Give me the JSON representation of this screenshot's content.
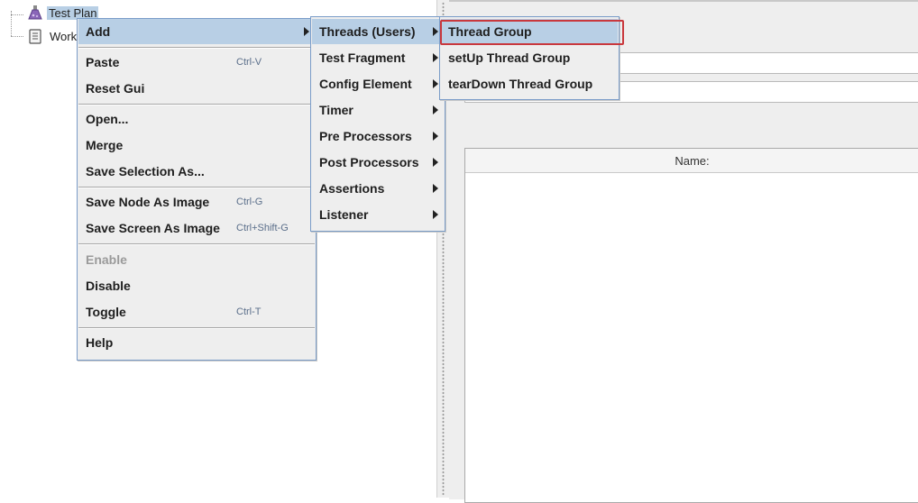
{
  "tree": {
    "root_label": "Test Plan",
    "child_label": "Work"
  },
  "right_panel": {
    "table_header": "Name:"
  },
  "context_menu": {
    "items": [
      {
        "label": "Add",
        "has_submenu": true
      },
      {
        "label": "Paste",
        "shortcut": "Ctrl-V"
      },
      {
        "label": "Reset Gui"
      },
      {
        "label": "Open..."
      },
      {
        "label": "Merge"
      },
      {
        "label": "Save Selection As..."
      },
      {
        "label": "Save Node As Image",
        "shortcut": "Ctrl-G"
      },
      {
        "label": "Save Screen As Image",
        "shortcut": "Ctrl+Shift-G"
      },
      {
        "label": "Enable",
        "disabled": true
      },
      {
        "label": "Disable"
      },
      {
        "label": "Toggle",
        "shortcut": "Ctrl-T"
      },
      {
        "label": "Help"
      }
    ]
  },
  "add_submenu": {
    "items": [
      {
        "label": "Threads (Users)"
      },
      {
        "label": "Test Fragment"
      },
      {
        "label": "Config Element"
      },
      {
        "label": "Timer"
      },
      {
        "label": "Pre Processors"
      },
      {
        "label": "Post Processors"
      },
      {
        "label": "Assertions"
      },
      {
        "label": "Listener"
      }
    ]
  },
  "threads_submenu": {
    "items": [
      {
        "label": "Thread Group"
      },
      {
        "label": "setUp Thread Group"
      },
      {
        "label": "tearDown Thread Group"
      }
    ]
  },
  "colors": {
    "highlight": "#b8cfe5",
    "focus_ring": "#c9383d",
    "menu_border": "#7a9cc8"
  }
}
